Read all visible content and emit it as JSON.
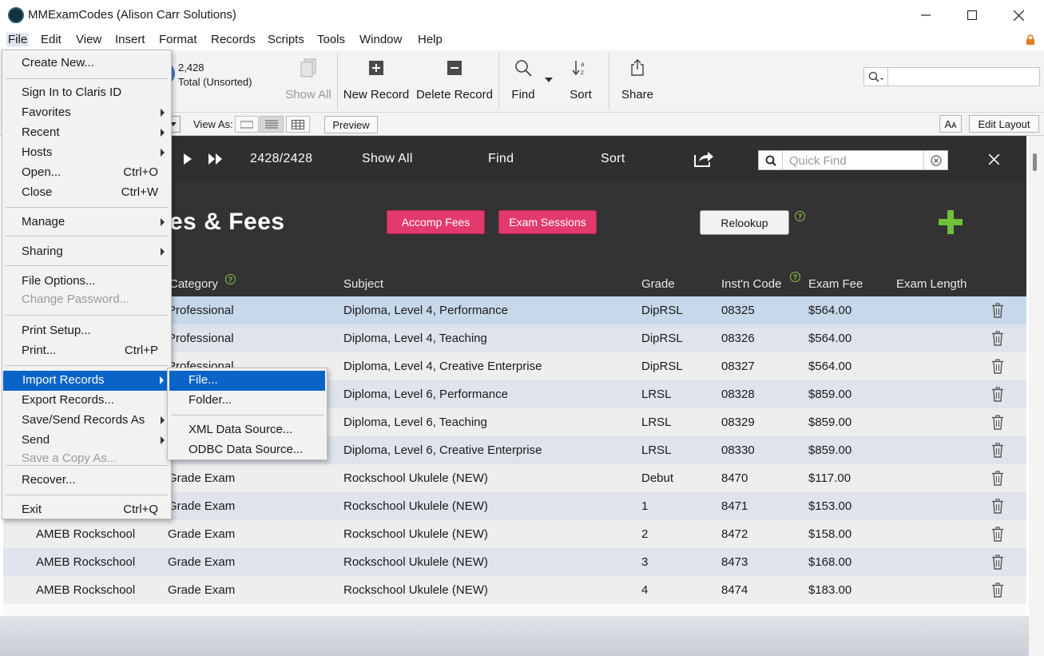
{
  "window": {
    "title": "MMExamCodes (Alison Carr Solutions)",
    "controls": {
      "minimize": "─",
      "maximize": "☐",
      "close": "✕"
    }
  },
  "menubar": {
    "items": [
      "File",
      "Edit",
      "View",
      "Insert",
      "Format",
      "Records",
      "Scripts",
      "Tools",
      "Window",
      "Help"
    ],
    "active": "File"
  },
  "toolbar": {
    "record_count": "2,428",
    "record_status": "Total (Unsorted)",
    "show_all": "Show All",
    "new_record": "New Record",
    "delete_record": "Delete Record",
    "find": "Find",
    "sort": "Sort",
    "share": "Share"
  },
  "layoutbar": {
    "view_as": "View As:",
    "preview": "Preview",
    "text_size": "Aᴀ",
    "edit_layout": "Edit Layout"
  },
  "navbar": {
    "record_position": "2428/2428",
    "show_all": "Show All",
    "find": "Find",
    "sort": "Sort",
    "quick_find_placeholder": "Quick Find"
  },
  "header": {
    "title_visible": "es & Fees",
    "accomp_fees": "Accomp Fees",
    "exam_sessions": "Exam Sessions",
    "relookup": "Relookup",
    "help_symbol": "?"
  },
  "table": {
    "columns": [
      "Category",
      "Subject",
      "Grade",
      "Inst'n Code",
      "Exam Fee",
      "Exam Length"
    ],
    "rows": [
      {
        "board": "",
        "category": "Professional",
        "subject": "Diploma, Level 4, Performance",
        "grade": "DipRSL",
        "code": "08325",
        "fee": "$564.00",
        "length": ""
      },
      {
        "board": "",
        "category": "Professional",
        "subject": "Diploma, Level 4, Teaching",
        "grade": "DipRSL",
        "code": "08326",
        "fee": "$564.00",
        "length": ""
      },
      {
        "board": "",
        "category": "Professional",
        "subject": "Diploma, Level 4, Creative Enterprise",
        "grade": "DipRSL",
        "code": "08327",
        "fee": "$564.00",
        "length": ""
      },
      {
        "board": "",
        "category": "",
        "subject": "Diploma, Level 6, Performance",
        "grade": "LRSL",
        "code": "08328",
        "fee": "$859.00",
        "length": ""
      },
      {
        "board": "",
        "category": "",
        "subject": "Diploma, Level 6, Teaching",
        "grade": "LRSL",
        "code": "08329",
        "fee": "$859.00",
        "length": ""
      },
      {
        "board": "",
        "category": "",
        "subject": "Diploma, Level 6, Creative Enterprise",
        "grade": "LRSL",
        "code": "08330",
        "fee": "$859.00",
        "length": ""
      },
      {
        "board": "",
        "category": "Grade Exam",
        "subject": "Rockschool Ukulele (NEW)",
        "grade": "Debut",
        "code": "8470",
        "fee": "$117.00",
        "length": ""
      },
      {
        "board": "",
        "category": "Grade Exam",
        "subject": "Rockschool Ukulele (NEW)",
        "grade": "1",
        "code": "8471",
        "fee": "$153.00",
        "length": ""
      },
      {
        "board": "AMEB Rockschool",
        "category": "Grade Exam",
        "subject": "Rockschool Ukulele (NEW)",
        "grade": "2",
        "code": "8472",
        "fee": "$158.00",
        "length": ""
      },
      {
        "board": "AMEB Rockschool",
        "category": "Grade Exam",
        "subject": "Rockschool Ukulele (NEW)",
        "grade": "3",
        "code": "8473",
        "fee": "$168.00",
        "length": ""
      },
      {
        "board": "AMEB Rockschool",
        "category": "Grade Exam",
        "subject": "Rockschool Ukulele (NEW)",
        "grade": "4",
        "code": "8474",
        "fee": "$183.00",
        "length": ""
      }
    ]
  },
  "file_menu": {
    "items": [
      {
        "label": "Create New...",
        "shortcut": "",
        "submenu": false,
        "disabled": false
      },
      {
        "label": "Sign In to Claris ID",
        "shortcut": "",
        "submenu": false,
        "disabled": false
      },
      {
        "label": "Favorites",
        "shortcut": "",
        "submenu": true,
        "disabled": false
      },
      {
        "label": "Recent",
        "shortcut": "",
        "submenu": true,
        "disabled": false
      },
      {
        "label": "Hosts",
        "shortcut": "",
        "submenu": true,
        "disabled": false
      },
      {
        "label": "Open...",
        "shortcut": "Ctrl+O",
        "submenu": false,
        "disabled": false
      },
      {
        "label": "Close",
        "shortcut": "Ctrl+W",
        "submenu": false,
        "disabled": false
      },
      {
        "label": "Manage",
        "shortcut": "",
        "submenu": true,
        "disabled": false
      },
      {
        "label": "Sharing",
        "shortcut": "",
        "submenu": true,
        "disabled": false
      },
      {
        "label": "File Options...",
        "shortcut": "",
        "submenu": false,
        "disabled": false
      },
      {
        "label": "Change Password...",
        "shortcut": "",
        "submenu": false,
        "disabled": true
      },
      {
        "label": "Print Setup...",
        "shortcut": "",
        "submenu": false,
        "disabled": false
      },
      {
        "label": "Print...",
        "shortcut": "Ctrl+P",
        "submenu": false,
        "disabled": false
      },
      {
        "label": "Import Records",
        "shortcut": "",
        "submenu": true,
        "disabled": false
      },
      {
        "label": "Export Records...",
        "shortcut": "",
        "submenu": false,
        "disabled": false
      },
      {
        "label": "Save/Send Records As",
        "shortcut": "",
        "submenu": true,
        "disabled": false
      },
      {
        "label": "Send",
        "shortcut": "",
        "submenu": true,
        "disabled": false
      },
      {
        "label": "Save a Copy As...",
        "shortcut": "",
        "submenu": false,
        "disabled": true
      },
      {
        "label": "Recover...",
        "shortcut": "",
        "submenu": false,
        "disabled": false
      },
      {
        "label": "Exit",
        "shortcut": "Ctrl+Q",
        "submenu": false,
        "disabled": false
      }
    ],
    "highlighted": "Import Records"
  },
  "import_submenu": {
    "items": [
      "File...",
      "Folder...",
      "XML Data Source...",
      "ODBC Data Source..."
    ],
    "highlighted": "File..."
  },
  "colors": {
    "accent_pink": "#e33a6c",
    "menu_highlight": "#0a64c8",
    "header_dark": "#2f2f2f",
    "add_green": "#6fbf3a"
  }
}
